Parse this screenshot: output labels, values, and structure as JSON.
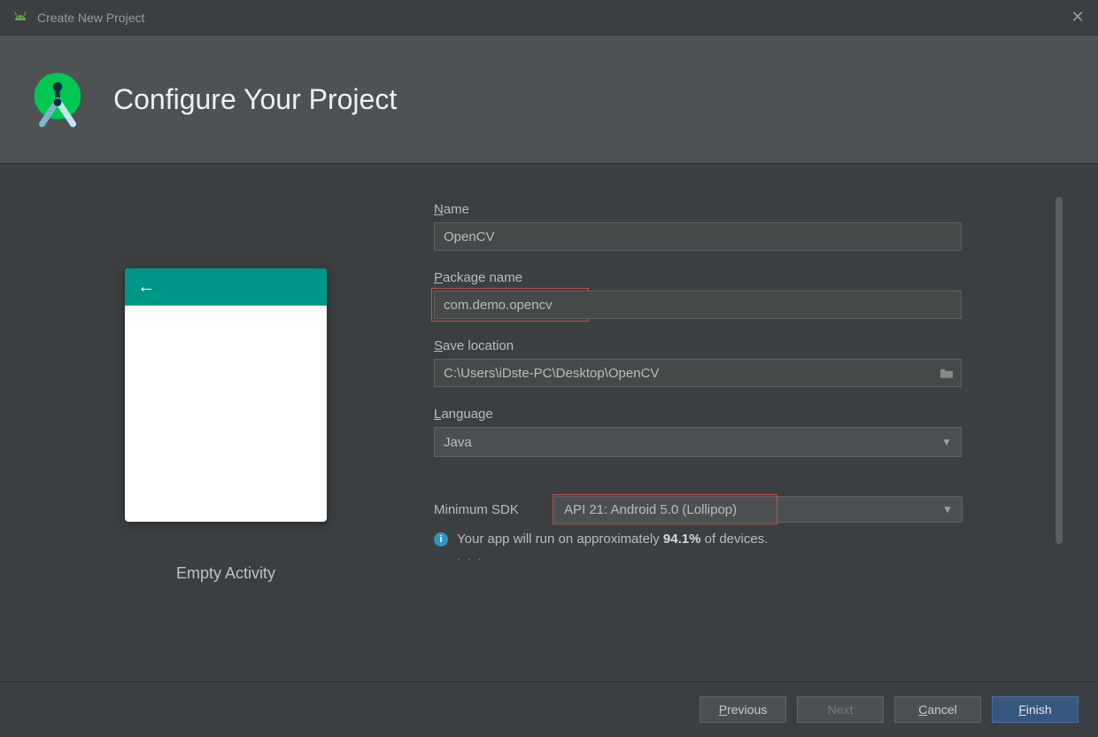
{
  "window": {
    "title": "Create New Project"
  },
  "header": {
    "title": "Configure Your Project"
  },
  "preview": {
    "template_name": "Empty Activity"
  },
  "form": {
    "name": {
      "label_pre": "N",
      "label_post": "ame",
      "value": "OpenCV"
    },
    "package": {
      "label_pre": "P",
      "label_post": "ackage name",
      "value": "com.demo.opencv"
    },
    "save": {
      "label_pre": "S",
      "label_post": "ave location",
      "value": "C:\\Users\\iDste-PC\\Desktop\\OpenCV"
    },
    "language": {
      "label_pre": "L",
      "label_post": "anguage",
      "value": "Java"
    },
    "sdk": {
      "label": "Minimum SDK",
      "value": "API 21: Android 5.0 (Lollipop)"
    },
    "info": {
      "text_pre": "Your app will run on approximately ",
      "percent": "94.1%",
      "text_post": " of devices."
    }
  },
  "footer": {
    "previous_pre": "P",
    "previous_post": "revious",
    "next": "Next",
    "cancel_pre": "C",
    "cancel_post": "ancel",
    "finish_pre": "F",
    "finish_post": "inish"
  }
}
